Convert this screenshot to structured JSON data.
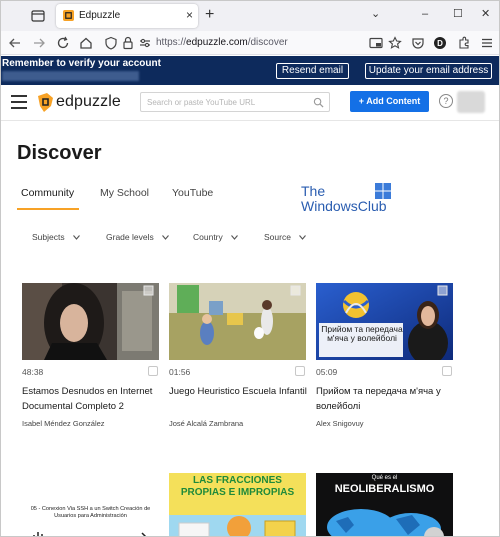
{
  "browser": {
    "tab_title": "Edpuzzle",
    "close_glyph": "×",
    "new_tab_glyph": "+",
    "url_prefix": "https://",
    "url_host": "edpuzzle.com",
    "url_path": "/discover",
    "window_controls": [
      "⌄",
      "–",
      "☐",
      "✕"
    ]
  },
  "banner": {
    "message": "Remember to verify your account",
    "resend_label": "Resend email",
    "update_label": "Update your email address",
    "background": "#0d2a5c"
  },
  "header": {
    "logo_text": "edpuzzle",
    "search_placeholder": "Search or paste YouTube URL",
    "add_content_label": "+ Add Content",
    "help_glyph": "?",
    "accent": "#1470e6",
    "logo_color": "#f7a226"
  },
  "page": {
    "title": "Discover",
    "tabs": [
      {
        "label": "Community",
        "active": true
      },
      {
        "label": "My School",
        "active": false
      },
      {
        "label": "YouTube",
        "active": false
      }
    ],
    "filters": [
      {
        "label": "Subjects"
      },
      {
        "label": "Grade levels"
      },
      {
        "label": "Country"
      },
      {
        "label": "Source"
      }
    ]
  },
  "watermark": {
    "line1": "The",
    "line2": "WindowsClub"
  },
  "cards": [
    {
      "duration": "48:38",
      "title": "Estamos Desnudos en Internet Documental Completo 2",
      "author": "Isabel Méndez González"
    },
    {
      "duration": "01:56",
      "title": "Juego Heuristico Escuela Infantil",
      "author": "José Alcalá Zambrana"
    },
    {
      "duration": "05:09",
      "title": "Прийом та передача м'яча у волейболі",
      "author": "Alex Snigovuy",
      "thumb_text": "Прийом та передача м'яча у волейболі"
    },
    {
      "thumb_text": "05 - Conexion Via SSH a un Switch Creación de Usuarios para Administración"
    },
    {
      "thumb_text": "LAS FRACCIONES PROPIAS E IMPROPIAS"
    },
    {
      "thumb_text_top": "Qué es el",
      "thumb_text": "NEOLIBERALISMO"
    }
  ]
}
